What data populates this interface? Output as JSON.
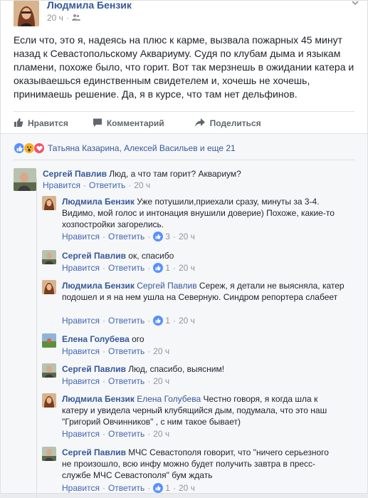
{
  "post": {
    "author": "Людмила Бензик",
    "time": "20 ч",
    "text": "Если что, это я, надеясь на плюс к карме, вызвала пожарных 45 минут назад к Севастопольскому Аквариуму. Судя по клубам дыма и языкам пламени, похоже было, что горит. Вот так мерзнешь в ожидании катера и оказываешься единственным свидетелем и, хочешь не хочешь, принимаешь решение. Да, я в курсе, что там нет дельфинов."
  },
  "actions": {
    "like": "Нравится",
    "comment": "Комментарий",
    "share": "Поделиться"
  },
  "reactions": {
    "names": "Татьяна Казарина, Алексей Васильев и еще 21"
  },
  "labels": {
    "like": "Нравится",
    "reply": "Ответить"
  },
  "comments": [
    {
      "author": "Сергей Павлив",
      "tag": "",
      "text": "Люд, а что там горит? Аквариум?",
      "likes": "",
      "time": "20 ч"
    },
    {
      "author": "Людмила Бензик",
      "tag": "",
      "text": "Уже потушили,приехали сразу, минуты за 3-4. Видимо, мой голос и интонация внушили доверие) Похоже, какие-то хозпостройки загорелись.",
      "likes": "3",
      "time": "20 ч"
    },
    {
      "author": "Сергей Павлив",
      "tag": "",
      "text": "ок, спасибо",
      "likes": "1",
      "time": "20 ч"
    },
    {
      "author": "Людмила Бензик",
      "tag": "Сергей Павлив",
      "text": "Сереж, я детали не выясняла, катер подошел и я на нем ушла на Северную. Синдром репортера слабеет",
      "likes": "1",
      "time": "20 ч"
    },
    {
      "author": "Елена Голубева",
      "tag": "",
      "text": "ого",
      "likes": "",
      "time": "20 ч"
    },
    {
      "author": "Сергей Павлив",
      "tag": "",
      "text": "Люд, спасибо, выясним!",
      "likes": "",
      "time": "20 ч"
    },
    {
      "author": "Людмила Бензик",
      "tag": "Елена Голубева",
      "text": "Честно говоря, я когда шла к катеру и увидела черный клубящийся дым, подумала, что это наш \"Григорий Овчинников\" , с ним такое бывает)",
      "likes": "",
      "time": "20 ч"
    },
    {
      "author": "Сергей Павлив",
      "tag": "",
      "text": "МЧС Севастополя говорит, что \"ничего серьезного не произошло, всю инфу можно будет получить завтра в пресс-службе МЧС Севастополя\" бум ждать",
      "likes": "1",
      "time": "20 ч"
    }
  ],
  "colors": {
    "link": "#365899",
    "meta": "#90949c",
    "like_blue": "#5890ff",
    "love_red": "#f25268",
    "wow_yellow": "#f7b125"
  },
  "icons": [
    "friends-icon",
    "chevron-down-icon",
    "like-thumb-icon",
    "comment-icon",
    "share-icon",
    "like-reaction-icon",
    "wow-reaction-icon",
    "love-reaction-icon"
  ]
}
